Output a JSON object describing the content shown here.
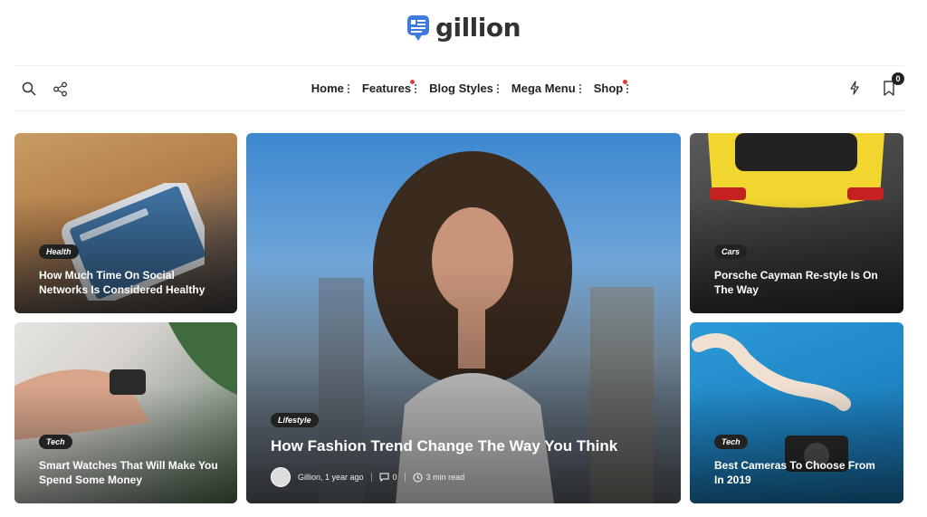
{
  "brand": {
    "name": "gillion",
    "accent": "#3f7ae0"
  },
  "nav": {
    "items": [
      {
        "label": "Home",
        "new": false
      },
      {
        "label": "Features",
        "new": true
      },
      {
        "label": "Blog Styles",
        "new": false
      },
      {
        "label": "Mega Menu",
        "new": false
      },
      {
        "label": "Shop",
        "new": true
      }
    ],
    "cart_count": "0"
  },
  "cards": {
    "health": {
      "tag": "Health",
      "title": "How Much Time On Social Networks Is Considered Healthy"
    },
    "watch": {
      "tag": "Tech",
      "title": "Smart Watches That Will Make You Spend Some Money"
    },
    "featured": {
      "tag": "Lifestyle",
      "title": "How Fashion Trend Change The Way You Think",
      "author": "Gillion, 1 year ago",
      "comments": "0",
      "read_time": "3 min read"
    },
    "cars": {
      "tag": "Cars",
      "title": "Porsche Cayman Re-style Is On The Way"
    },
    "camera": {
      "tag": "Tech",
      "title": "Best Cameras To Choose From In 2019"
    }
  }
}
